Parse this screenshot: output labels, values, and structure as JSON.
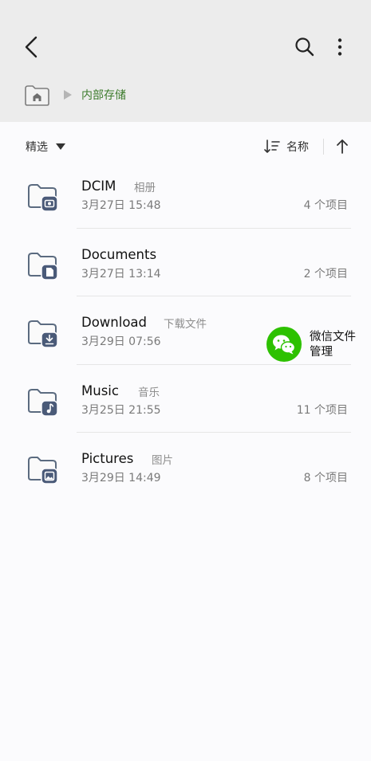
{
  "breadcrumb": {
    "current": "内部存储"
  },
  "sortbar": {
    "filter_label": "精选",
    "sort_label": "名称"
  },
  "folders": [
    {
      "name": "DCIM",
      "sub": "相册",
      "date": "3月27日 15:48",
      "count": "4 个项目",
      "badge": "camera-icon"
    },
    {
      "name": "Documents",
      "sub": "",
      "date": "3月27日 13:14",
      "count": "2 个项目",
      "badge": "document-icon"
    },
    {
      "name": "Download",
      "sub": "下载文件",
      "date": "3月29日 07:56",
      "count": "",
      "badge": "download-icon"
    },
    {
      "name": "Music",
      "sub": "音乐",
      "date": "3月25日 21:55",
      "count": "11 个项目",
      "badge": "music-note-icon"
    },
    {
      "name": "Pictures",
      "sub": "图片",
      "date": "3月29日 14:49",
      "count": "8 个项目",
      "badge": "image-icon"
    }
  ],
  "wechat_bubble": {
    "line1": "微信文件",
    "line2": "管理"
  },
  "colors": {
    "header_bg": "#ececec",
    "accent_green": "#3c7b2c",
    "folder_stroke": "#5b6b80",
    "badge_fill": "#4a5a78",
    "wechat_green": "#2dc100"
  }
}
